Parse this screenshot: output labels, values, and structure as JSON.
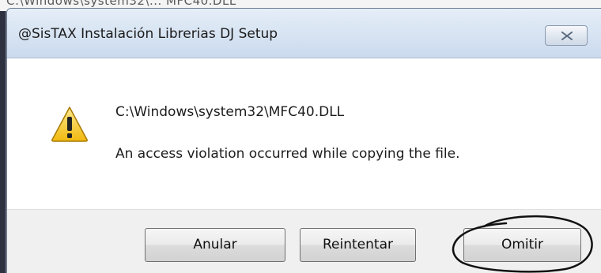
{
  "background_window": {
    "clipped_title": "C:\\Windows\\system32\\...  MFC40.DLL"
  },
  "dialog": {
    "title": "@SisTAX Instalación Librerias DJ Setup",
    "close_icon": "close-icon",
    "icon": "warning-icon",
    "file_path": "C:\\Windows\\system32\\MFC40.DLL",
    "message": "An access violation occurred while copying the file."
  },
  "buttons": {
    "abort_label": "Anular",
    "retry_label": "Reintentar",
    "ignore_label": "Omitir"
  },
  "colors": {
    "titlebar": "#d9e5f3",
    "footer": "#f0f0f0",
    "warning_fill": "#f5c518",
    "annotation_stroke": "#111111"
  }
}
